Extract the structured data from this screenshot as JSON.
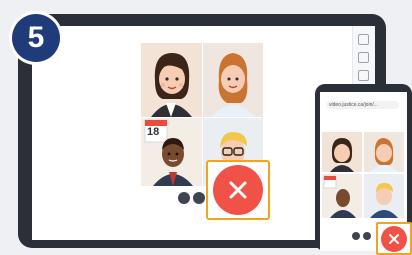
{
  "step_badge": {
    "number": "5",
    "color": "#1f3b7a"
  },
  "call": {
    "participants": [
      {
        "name": "participant-woman-dark-hair"
      },
      {
        "name": "participant-woman-ponytail"
      },
      {
        "name": "participant-man-dark-skin"
      },
      {
        "name": "participant-man-blond-glasses"
      }
    ],
    "calendar_day": "18",
    "leave_button": {
      "icon": "close-icon",
      "color": "#f05247",
      "highlight": "#f2a51c"
    }
  },
  "phone": {
    "url": "video.justice.ca/join/..."
  }
}
